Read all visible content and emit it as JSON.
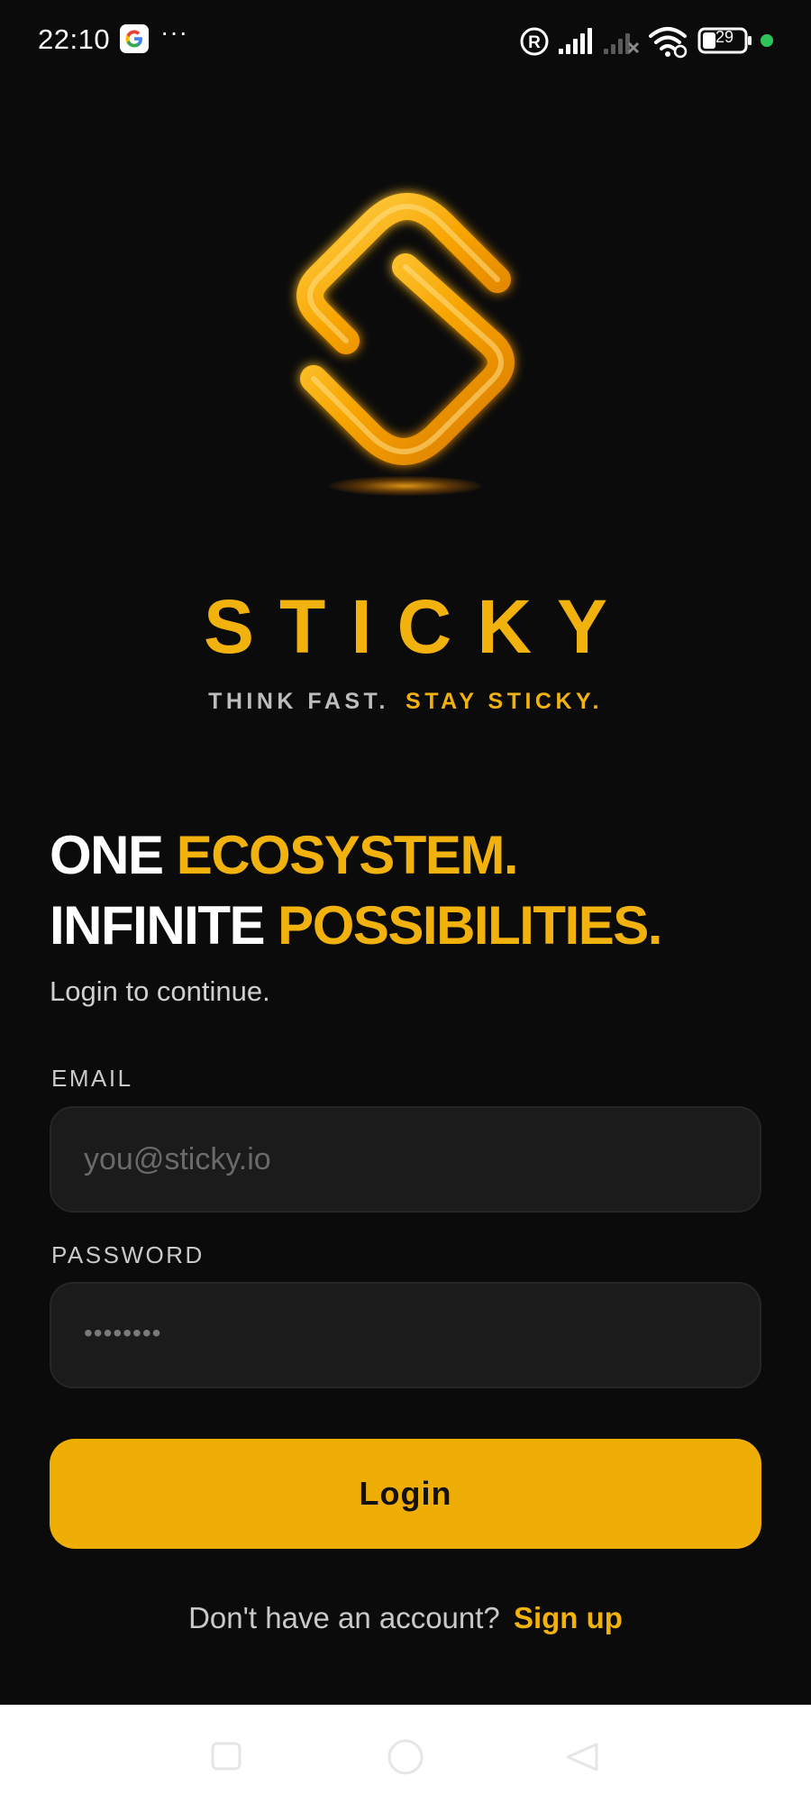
{
  "status_bar": {
    "time": "22:10",
    "dots": "···",
    "battery_level": "29",
    "icons": [
      "google-icon",
      "registered-icon",
      "signal-icon",
      "signal-off-icon",
      "wifi-icon",
      "battery-icon",
      "status-dot-icon"
    ]
  },
  "branding": {
    "app_name": "STICKY",
    "tagline_part1": "THINK FAST.",
    "tagline_part2": "STAY STICKY.",
    "accent_color": "#f2b20e"
  },
  "headline": {
    "line1_white": "ONE ",
    "line1_accent": "ECOSYSTEM.",
    "line2_white": "INFINITE ",
    "line2_accent": "POSSIBILITIES."
  },
  "subtitle": "Login to continue.",
  "form": {
    "email_label": "EMAIL",
    "email_placeholder": "you@sticky.io",
    "email_value": "",
    "password_label": "PASSWORD",
    "password_masked": "••••••••"
  },
  "login_button": {
    "label": "Login",
    "color": "#efae06"
  },
  "signup": {
    "prompt": "Don't have an account?",
    "link": "Sign up"
  },
  "nav_bar": {
    "icons": [
      "recents-icon",
      "home-icon",
      "back-icon"
    ]
  }
}
